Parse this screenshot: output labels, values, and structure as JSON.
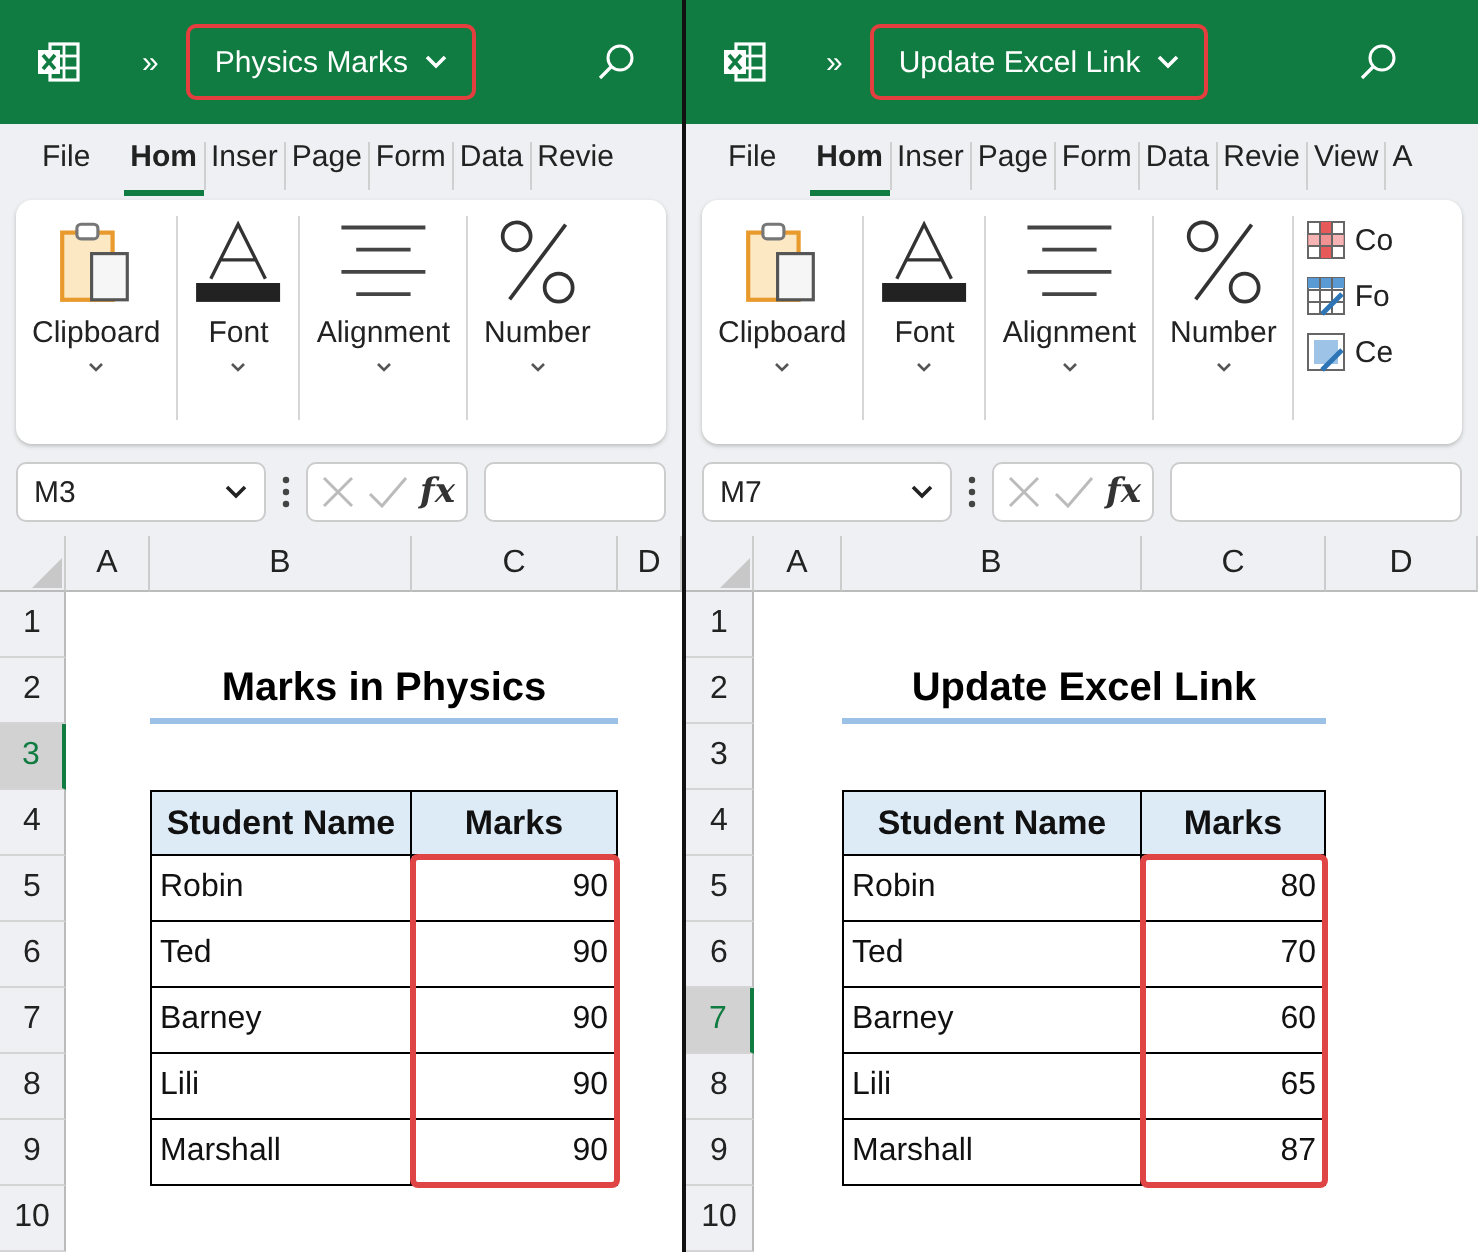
{
  "windows": [
    {
      "overflow_button": "»",
      "title": "Physics Marks",
      "tabs": [
        {
          "label": "File",
          "selected": false
        },
        {
          "label": "Hom",
          "selected": true
        },
        {
          "label": "Inser",
          "selected": false
        },
        {
          "label": "Page",
          "selected": false
        },
        {
          "label": "Form",
          "selected": false
        },
        {
          "label": "Data",
          "selected": false
        },
        {
          "label": "Revie",
          "selected": false
        }
      ],
      "ribbon_groups": [
        {
          "kind": "clipboard",
          "label": "Clipboard"
        },
        {
          "kind": "font",
          "label": "Font"
        },
        {
          "kind": "alignment",
          "label": "Alignment"
        },
        {
          "kind": "number",
          "label": "Number"
        }
      ],
      "name_box": "M3",
      "function_button": "fx",
      "columns": [
        "A",
        "B",
        "C",
        "D"
      ],
      "rows": [
        {
          "label": "1",
          "selected": false
        },
        {
          "label": "2",
          "selected": false
        },
        {
          "label": "3",
          "selected": true
        },
        {
          "label": "4",
          "selected": false
        },
        {
          "label": "5",
          "selected": false
        },
        {
          "label": "6",
          "selected": false
        },
        {
          "label": "7",
          "selected": false
        },
        {
          "label": "8",
          "selected": false
        },
        {
          "label": "9",
          "selected": false
        },
        {
          "label": "10",
          "selected": false
        }
      ],
      "heading": "Marks in Physics",
      "table": {
        "columns": [
          "Student Name",
          "Marks"
        ],
        "rows": [
          [
            "Robin",
            "90"
          ],
          [
            "Ted",
            "90"
          ],
          [
            "Barney",
            "90"
          ],
          [
            "Lili",
            "90"
          ],
          [
            "Marshall",
            "90"
          ]
        ]
      }
    },
    {
      "overflow_button": "»",
      "title": "Update Excel Link",
      "tabs": [
        {
          "label": "File",
          "selected": false
        },
        {
          "label": "Hom",
          "selected": true
        },
        {
          "label": "Inser",
          "selected": false
        },
        {
          "label": "Page",
          "selected": false
        },
        {
          "label": "Form",
          "selected": false
        },
        {
          "label": "Data",
          "selected": false
        },
        {
          "label": "Revie",
          "selected": false
        },
        {
          "label": "View",
          "selected": false
        },
        {
          "label": "A",
          "selected": false
        }
      ],
      "ribbon_groups": [
        {
          "kind": "clipboard",
          "label": "Clipboard"
        },
        {
          "kind": "font",
          "label": "Font"
        },
        {
          "kind": "alignment",
          "label": "Alignment"
        },
        {
          "kind": "number",
          "label": "Number"
        }
      ],
      "ribbon_commands": [
        {
          "kind": "conditional",
          "label": "Co"
        },
        {
          "kind": "table",
          "label": "Fo"
        },
        {
          "kind": "styles",
          "label": "Ce"
        }
      ],
      "name_box": "M7",
      "function_button": "fx",
      "columns": [
        "A",
        "B",
        "C",
        "D"
      ],
      "rows": [
        {
          "label": "1",
          "selected": false
        },
        {
          "label": "2",
          "selected": false
        },
        {
          "label": "3",
          "selected": false
        },
        {
          "label": "4",
          "selected": false
        },
        {
          "label": "5",
          "selected": false
        },
        {
          "label": "6",
          "selected": false
        },
        {
          "label": "7",
          "selected": true
        },
        {
          "label": "8",
          "selected": false
        },
        {
          "label": "9",
          "selected": false
        },
        {
          "label": "10",
          "selected": false
        }
      ],
      "heading": "Update Excel Link",
      "table": {
        "columns": [
          "Student Name",
          "Marks"
        ],
        "rows": [
          [
            "Robin",
            "80"
          ],
          [
            "Ted",
            "70"
          ],
          [
            "Barney",
            "60"
          ],
          [
            "Lili",
            "65"
          ],
          [
            "Marshall",
            "87"
          ]
        ]
      }
    }
  ]
}
